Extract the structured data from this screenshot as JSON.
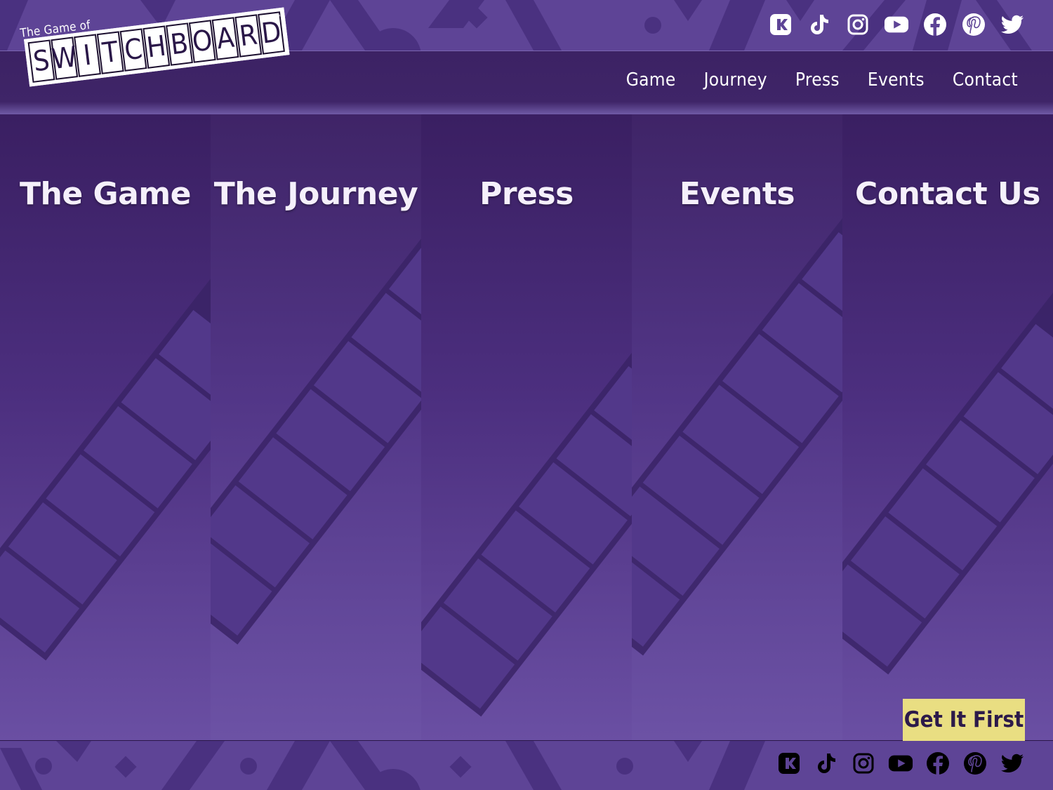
{
  "brand": {
    "kicker": "The Game of",
    "letters": [
      "S",
      "W",
      "I",
      "T",
      "C",
      "H",
      "B",
      "O",
      "A",
      "R",
      "D"
    ],
    "tm": "™"
  },
  "social": [
    {
      "name": "kickstarter-icon"
    },
    {
      "name": "tiktok-icon"
    },
    {
      "name": "instagram-icon"
    },
    {
      "name": "youtube-icon"
    },
    {
      "name": "facebook-icon"
    },
    {
      "name": "pinterest-icon"
    },
    {
      "name": "twitter-icon"
    }
  ],
  "nav": {
    "game": "Game",
    "journey": "Journey",
    "press": "Press",
    "events": "Events",
    "contact": "Contact"
  },
  "panels": {
    "game": "The Game",
    "journey": "The Journey",
    "press": "Press",
    "events": "Events",
    "contact": "Contact Us"
  },
  "cta": "Get It First",
  "colors": {
    "accent": "#e9de82",
    "header_bg": "#3c2264",
    "pattern_bg": "#5e4496"
  }
}
